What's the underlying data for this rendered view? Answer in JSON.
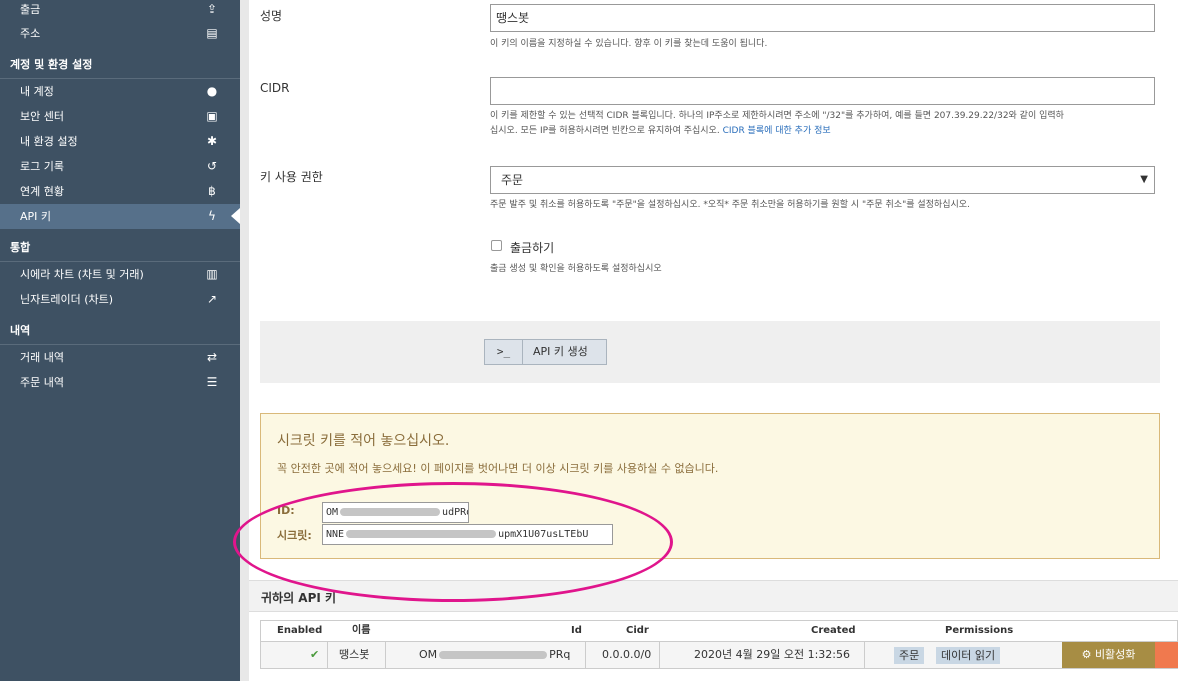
{
  "sidebar": {
    "items_top": [
      {
        "label": "출금",
        "icon": "upload-icon",
        "glyph": "⇪"
      },
      {
        "label": "주소",
        "icon": "document-icon",
        "glyph": "▤"
      }
    ],
    "section_account": "계정 및 환경 설정",
    "items_account": [
      {
        "label": "내 계정",
        "icon": "user-icon",
        "glyph": "●"
      },
      {
        "label": "보안 센터",
        "icon": "lock-icon",
        "glyph": "▣"
      },
      {
        "label": "내 환경 설정",
        "icon": "gear-icon",
        "glyph": "✱"
      },
      {
        "label": "로그 기록",
        "icon": "history-icon",
        "glyph": "↺"
      },
      {
        "label": "연계 현황",
        "icon": "bitcoin-icon",
        "glyph": "฿"
      },
      {
        "label": "API 키",
        "icon": "bolt-icon",
        "glyph": "ϟ"
      }
    ],
    "section_integration": "통합",
    "items_integration": [
      {
        "label": "시에라 차트 (차트 및 거래)",
        "icon": "bar-chart-icon",
        "glyph": "▥"
      },
      {
        "label": "닌자트레이더 (차트)",
        "icon": "line-chart-icon",
        "glyph": "↗"
      }
    ],
    "section_history": "내역",
    "items_history": [
      {
        "label": "거래 내역",
        "icon": "transfer-icon",
        "glyph": "⇄"
      },
      {
        "label": "주문 내역",
        "icon": "list-icon",
        "glyph": "☰"
      }
    ]
  },
  "form": {
    "name_label": "성명",
    "name_value": "땡스봇",
    "name_help": "이 키의 이름을 지정하실 수 있습니다. 향후 이 키를 찾는데 도움이 됩니다.",
    "cidr_label": "CIDR",
    "cidr_value": "",
    "cidr_help_1": "이 키를 제한할 수 있는 선택적 CIDR 블록입니다. 하나의 IP주소로 제한하시려면 주소에 \"/32\"를 추가하여, 예를 들면 207.39.29.22/32와 같이 입력하",
    "cidr_help_2": "십시오. 모든 IP를 허용하시려면 빈칸으로 유지하여 주십시오.",
    "cidr_help_link": "CIDR 블록에 대한 추가 정보",
    "perm_label": "키 사용 권한",
    "perm_value": "주문",
    "perm_help": "주문 발주 및 취소를 허용하도록 \"주문\"을 설정하십시오. *오직* 주문 취소만을 허용하기를 원할 시 \"주문 취소\"를 설정하십시오.",
    "withdraw_label": "출금하기",
    "withdraw_help": "출금 생성 및 확인을 허용하도록 설정하십시오",
    "generate_button": "API 키 생성",
    "terminal_glyph": ">_"
  },
  "secret": {
    "title": "시크릿 키를 적어 놓으십시오.",
    "warning": "꼭 안전한 곳에 적어 놓으세요! 이 페이지를 벗어나면 더 이상 시크릿 키를 사용하실 수 없습니다.",
    "id_label": "ID:",
    "id_start": "OM",
    "id_end": "udPRq",
    "secret_label": "시크릿:",
    "secret_start": "NNE",
    "secret_end": "upmX1U07usLTEbU"
  },
  "api_keys": {
    "title": "귀하의 API 키",
    "columns": {
      "enabled": "Enabled",
      "name": "이름",
      "id": "Id",
      "cidr": "Cidr",
      "created": "Created",
      "permissions": "Permissions"
    },
    "row": {
      "enabled_icon": "✔",
      "name": "땡스봇",
      "id_start": "OM",
      "id_end": "PRq",
      "cidr": "0.0.0.0/0",
      "created": "2020년 4월 29일 오전 1:32:56",
      "perm_1": "주문",
      "perm_2": "데이터 읽기",
      "deactivate": "비활성화",
      "deactivate_icon": "⚙"
    }
  },
  "colors": {
    "sidebar": "#3e5163",
    "highlight": "#e0158c",
    "warning_bg": "#fcf8e3",
    "deactivate": "#a78d44",
    "delete": "#f0794e"
  }
}
